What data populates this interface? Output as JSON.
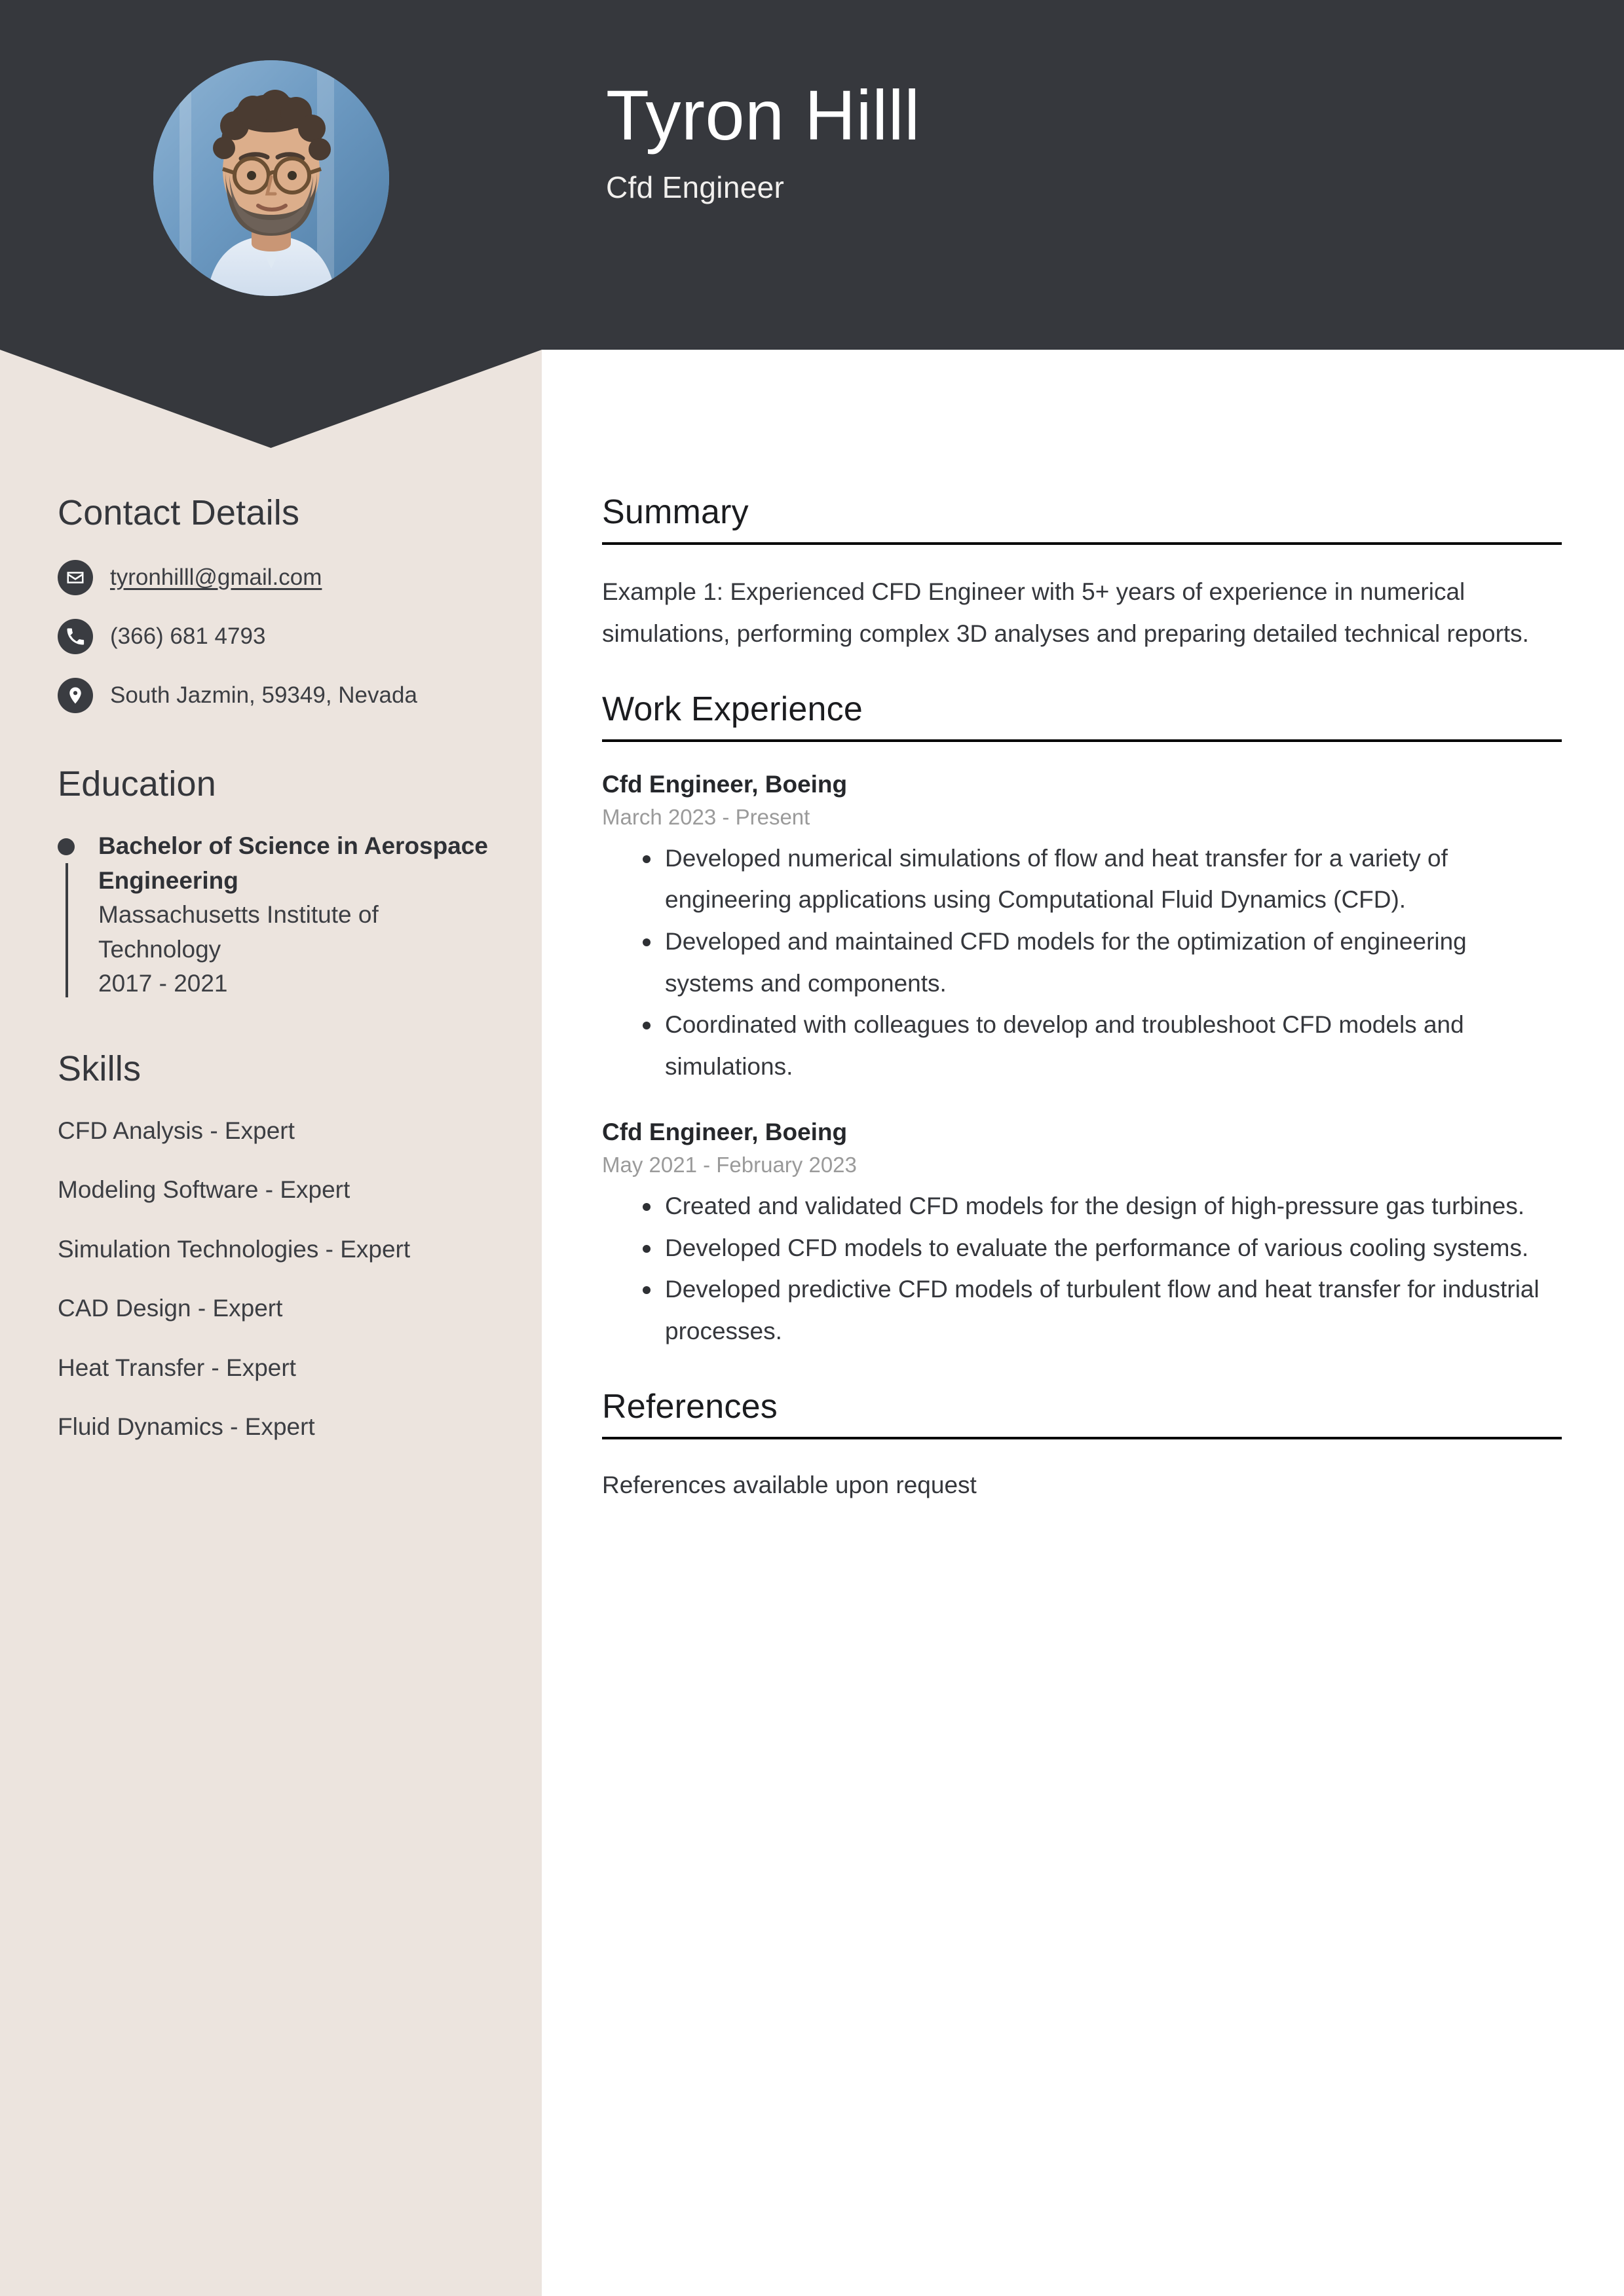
{
  "theme": {
    "header_bg": "#36383d",
    "sidebar_bg": "#ece4de",
    "page_bg": "#ffffff",
    "text_dark": "#35373c",
    "muted_text": "#9a9a9a",
    "rule_color": "#000000"
  },
  "header": {
    "name": "Tyron Hilll",
    "job_title": "Cfd Engineer",
    "avatar_alt": "profile-photo"
  },
  "sidebar": {
    "contact": {
      "heading": "Contact Details",
      "items": [
        {
          "icon": "envelope-icon",
          "name": "email",
          "value": "tyronhilll@gmail.com",
          "link": true
        },
        {
          "icon": "phone-icon",
          "name": "phone",
          "value": "(366) 681 4793",
          "link": false
        },
        {
          "icon": "location-pin-icon",
          "name": "address",
          "value": "South Jazmin, 59349, Nevada",
          "link": false
        }
      ]
    },
    "education": {
      "heading": "Education",
      "items": [
        {
          "degree": "Bachelor of Science in Aerospace Engineering",
          "school": "Massachusetts Institute of Technology",
          "dates": "2017 - 2021"
        }
      ]
    },
    "skills": {
      "heading": "Skills",
      "items": [
        "CFD Analysis - Expert",
        "Modeling Software - Expert",
        "Simulation Technologies - Expert",
        "CAD Design - Expert",
        "Heat Transfer - Expert",
        "Fluid Dynamics - Expert"
      ]
    }
  },
  "main": {
    "summary": {
      "heading": "Summary",
      "text": "Example 1: Experienced CFD Engineer with 5+ years of experience in numerical simulations, performing complex 3D analyses and preparing detailed technical reports."
    },
    "work_experience": {
      "heading": "Work Experience",
      "jobs": [
        {
          "role": "Cfd Engineer, Boeing",
          "dates": "March 2023 - Present",
          "bullets": [
            "Developed numerical simulations of flow and heat transfer for a variety of engineering applications using Computational Fluid Dynamics (CFD).",
            "Developed and maintained CFD models for the optimization of engineering systems and components.",
            "Coordinated with colleagues to develop and troubleshoot CFD models and simulations."
          ]
        },
        {
          "role": "Cfd Engineer, Boeing",
          "dates": "May 2021 - February 2023",
          "bullets": [
            "Created and validated CFD models for the design of high-pressure gas turbines.",
            "Developed CFD models to evaluate the performance of various cooling systems.",
            "Developed predictive CFD models of turbulent flow and heat transfer for industrial processes."
          ]
        }
      ]
    },
    "references": {
      "heading": "References",
      "text": "References available upon request"
    }
  }
}
